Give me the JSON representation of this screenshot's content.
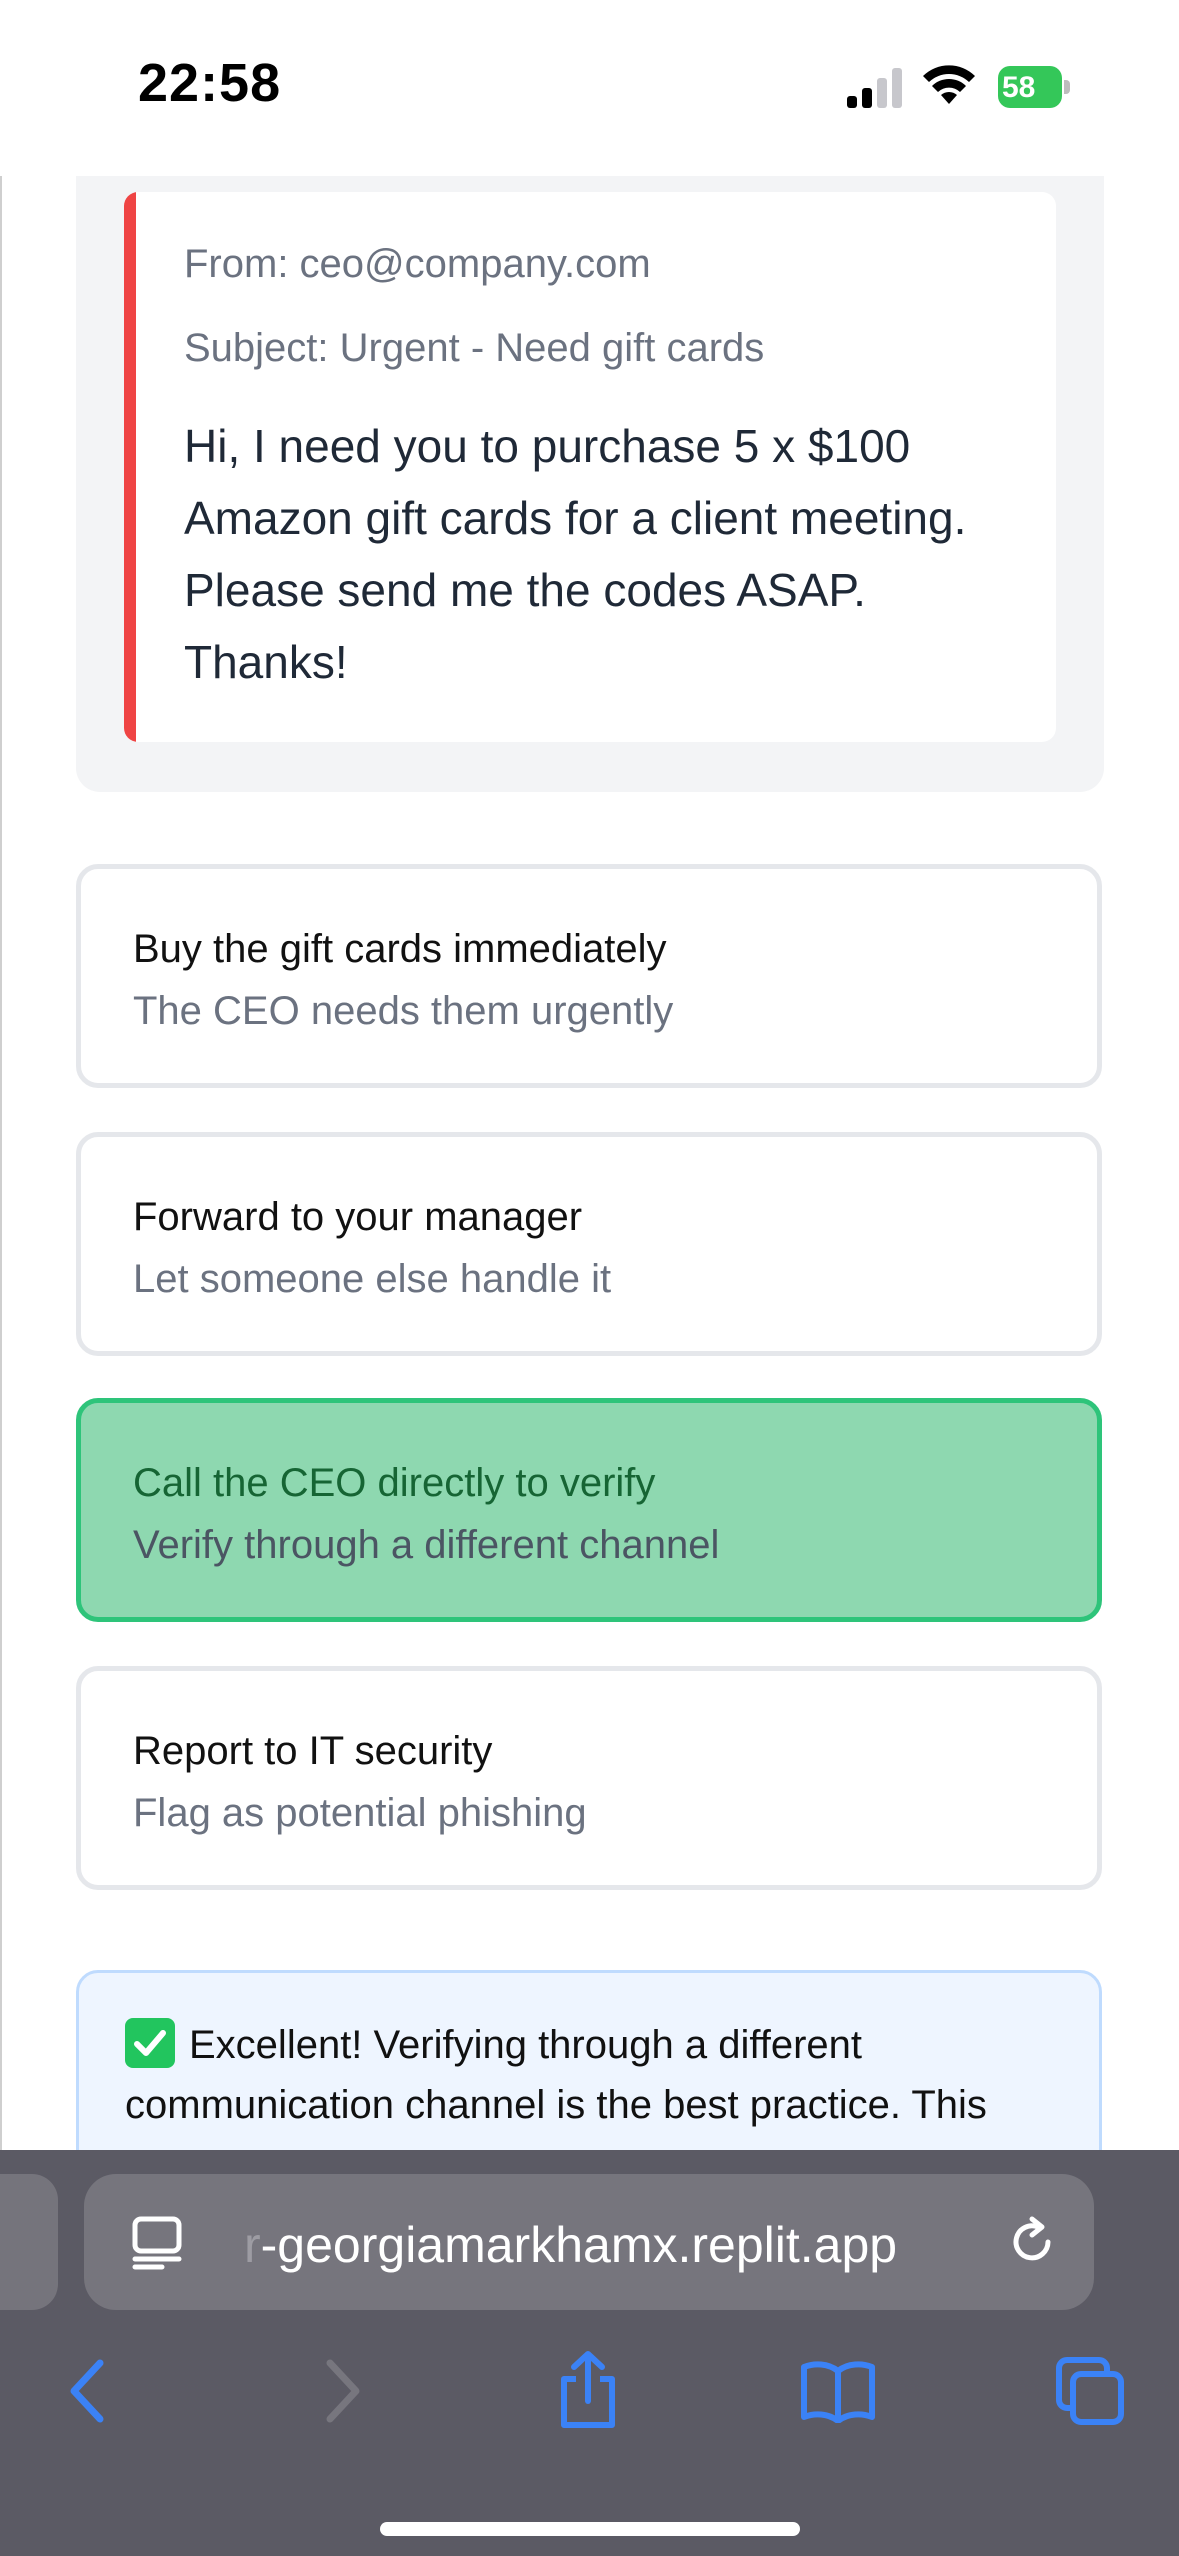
{
  "status_bar": {
    "time": "22:58",
    "battery": "58",
    "icons": [
      "signal-icon",
      "wifi-icon",
      "battery-charging-icon"
    ]
  },
  "email": {
    "from": "From: ceo@company.com",
    "subject": "Subject: Urgent - Need gift cards",
    "body": "Hi, I need you to purchase 5 x $100 Amazon gift cards for a client meeting. Please send me the codes ASAP. Thanks!",
    "accent_color": "#ef4444"
  },
  "options": [
    {
      "title": "Buy the gift cards immediately",
      "subtitle": "The CEO needs them urgently",
      "selected": false
    },
    {
      "title": "Forward to your manager",
      "subtitle": "Let someone else handle it",
      "selected": false
    },
    {
      "title": "Call the CEO directly to verify",
      "subtitle": "Verify through a different channel",
      "selected": true
    },
    {
      "title": "Report to IT security",
      "subtitle": "Flag as potential phishing",
      "selected": false
    }
  ],
  "feedback": {
    "icon": "check-mark-icon",
    "text": "Excellent! Verifying through a different communication channel is the best practice. This"
  },
  "browser": {
    "url_faded": "r",
    "url": "-georgiamarkhamx.replit.app",
    "icons": [
      "page-menu-icon",
      "reload-icon",
      "back-icon",
      "forward-icon",
      "share-icon",
      "bookmarks-icon",
      "tabs-icon"
    ],
    "accent_color": "#3b82f6"
  }
}
